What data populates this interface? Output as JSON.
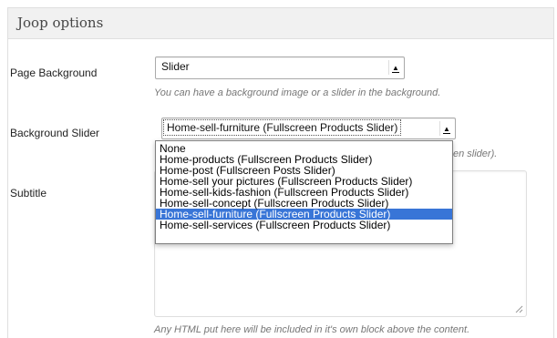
{
  "panel": {
    "title": "Joop options"
  },
  "page_background": {
    "label": "Page Background",
    "selected": "Slider",
    "description": "You can have a background image or a slider in the background."
  },
  "background_slider": {
    "label": "Background Slider",
    "selected": "Home-sell-furniture (Fullscreen Products Slider)",
    "description_visible_tail": "en slider).",
    "options": [
      "None",
      "Home-products (Fullscreen Products Slider)",
      "Home-post (Fullscreen Posts Slider)",
      "Home-sell your pictures (Fullscreen Products Slider)",
      "Home-sell-kids-fashion (Fullscreen Products Slider)",
      "Home-sell-concept (Fullscreen Products Slider)",
      "Home-sell-furniture (Fullscreen Products Slider)",
      "Home-sell-services (Fullscreen Products Slider)"
    ],
    "highlighted_index": 6
  },
  "subtitle": {
    "label": "Subtitle",
    "value": "",
    "description": "Any HTML put here will be included in it's own block above the content."
  },
  "colors": {
    "highlight": "#3875d7",
    "header_bg": "#f1f1f1",
    "border": "#dfdfdf"
  }
}
